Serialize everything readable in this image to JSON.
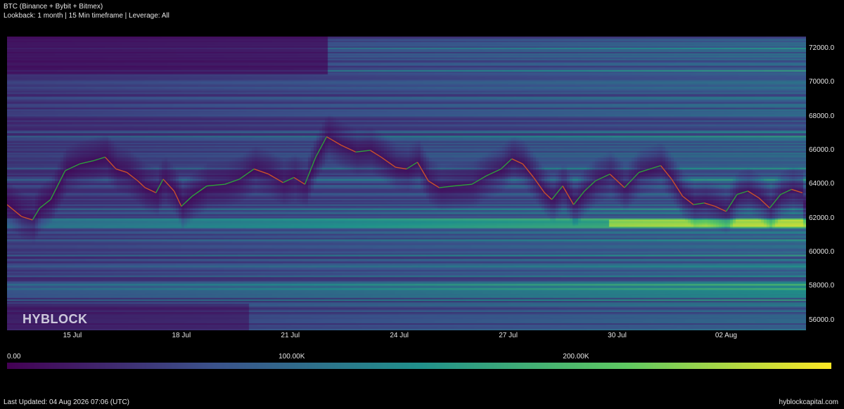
{
  "header": {
    "title": "BTC (Binance + Bybit + Bitmex)",
    "subtitle": "Lookback: 1 month | 15 Min timeframe | Leverage: All"
  },
  "watermark": "HYBLOCK",
  "footer": {
    "last_updated": "Last Updated: 04 Aug 2026 07:06 (UTC)",
    "site": "hyblockcapital.com"
  },
  "colors": {
    "background": "#000000",
    "price_line_up": "#2e9e3e",
    "price_line_down": "#c8522a",
    "colormap": [
      "#440154",
      "#3b528b",
      "#21918c",
      "#5ec962",
      "#fde725"
    ]
  },
  "chart_data": {
    "type": "heatmap",
    "title": "BTC (Binance + Bybit + Bitmex)",
    "xlabel": "",
    "ylabel": "",
    "x_ticks": [
      "15 Jul",
      "18 Jul",
      "21 Jul",
      "24 Jul",
      "27 Jul",
      "30 Jul",
      "02 Aug"
    ],
    "x_range_days": [
      13.2,
      35.2
    ],
    "x_tick_days": [
      15,
      18,
      21,
      24,
      27,
      30,
      33
    ],
    "y_ticks": [
      "56000.0",
      "58000.0",
      "60000.0",
      "62000.0",
      "64000.0",
      "66000.0",
      "68000.0",
      "70000.0",
      "72000.0"
    ],
    "y_tick_values": [
      56000,
      58000,
      60000,
      62000,
      64000,
      66000,
      68000,
      70000,
      72000
    ],
    "ylim": [
      55400,
      72700
    ],
    "colorbar": {
      "ticks": [
        "0.00",
        "100.00K",
        "200.00K"
      ],
      "tick_values": [
        0,
        100000,
        200000
      ],
      "max": 290000
    },
    "price_series": {
      "name": "",
      "days": [
        13.2,
        13.6,
        13.9,
        14.1,
        14.4,
        14.8,
        15.2,
        15.6,
        15.9,
        16.2,
        16.5,
        16.8,
        17.0,
        17.3,
        17.5,
        17.8,
        18.0,
        18.3,
        18.7,
        19.2,
        19.6,
        20.0,
        20.4,
        20.8,
        21.1,
        21.4,
        21.7,
        22.0,
        22.4,
        22.8,
        23.2,
        23.5,
        23.9,
        24.2,
        24.5,
        24.8,
        25.1,
        25.5,
        26.0,
        26.4,
        26.8,
        27.1,
        27.4,
        27.7,
        28.0,
        28.2,
        28.5,
        28.8,
        29.1,
        29.4,
        29.8,
        30.2,
        30.6,
        30.9,
        31.2,
        31.5,
        31.8,
        32.1,
        32.4,
        32.7,
        33.0,
        33.3,
        33.6,
        33.9,
        34.2,
        34.5,
        34.8,
        35.1
      ],
      "values": [
        62800,
        62100,
        61900,
        62600,
        63100,
        64800,
        65200,
        65400,
        65600,
        64900,
        64700,
        64200,
        63800,
        63500,
        64300,
        63600,
        62700,
        63300,
        63900,
        64000,
        64300,
        64900,
        64600,
        64100,
        64400,
        64000,
        65600,
        66800,
        66300,
        65900,
        66000,
        65600,
        65000,
        64900,
        65300,
        64200,
        63800,
        63900,
        64000,
        64500,
        64900,
        65500,
        65200,
        64400,
        63500,
        63100,
        63900,
        62800,
        63600,
        64200,
        64600,
        63800,
        64700,
        64900,
        65100,
        64300,
        63300,
        62800,
        62900,
        62700,
        62400,
        63400,
        63600,
        63200,
        62600,
        63400,
        63700,
        63500
      ]
    }
  }
}
